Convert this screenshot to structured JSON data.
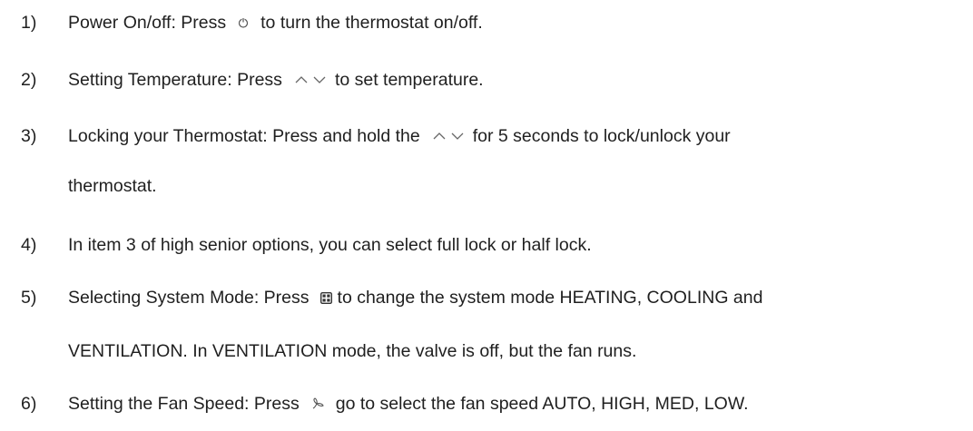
{
  "items": [
    {
      "number": "1)",
      "before": "Power On/off: Press",
      "icon": "power-icon",
      "after": "to turn the thermostat on/off."
    },
    {
      "number": "2)",
      "before": "Setting Temperature: Press",
      "icon": "up-down-arrows-icon",
      "after": "to set temperature."
    },
    {
      "number": "3)",
      "before": "Locking your Thermostat: Press and hold the",
      "icon": "up-down-arrows-icon",
      "after": "for 5 seconds to lock/unlock your",
      "continuation": "thermostat."
    },
    {
      "number": "4)",
      "text": "In item 3 of high senior options, you can select full lock or half lock."
    },
    {
      "number": "5)",
      "before": "Selecting System Mode: Press",
      "icon": "mode-grid-icon",
      "after": "to change the system mode HEATING, COOLING and",
      "continuation": "VENTILATION. In VENTILATION mode, the valve is off, but the fan runs."
    },
    {
      "number": "6)",
      "before": "Setting the Fan Speed: Press",
      "icon": "fan-icon",
      "after": "go to select the fan speed AUTO, HIGH, MED, LOW."
    }
  ]
}
